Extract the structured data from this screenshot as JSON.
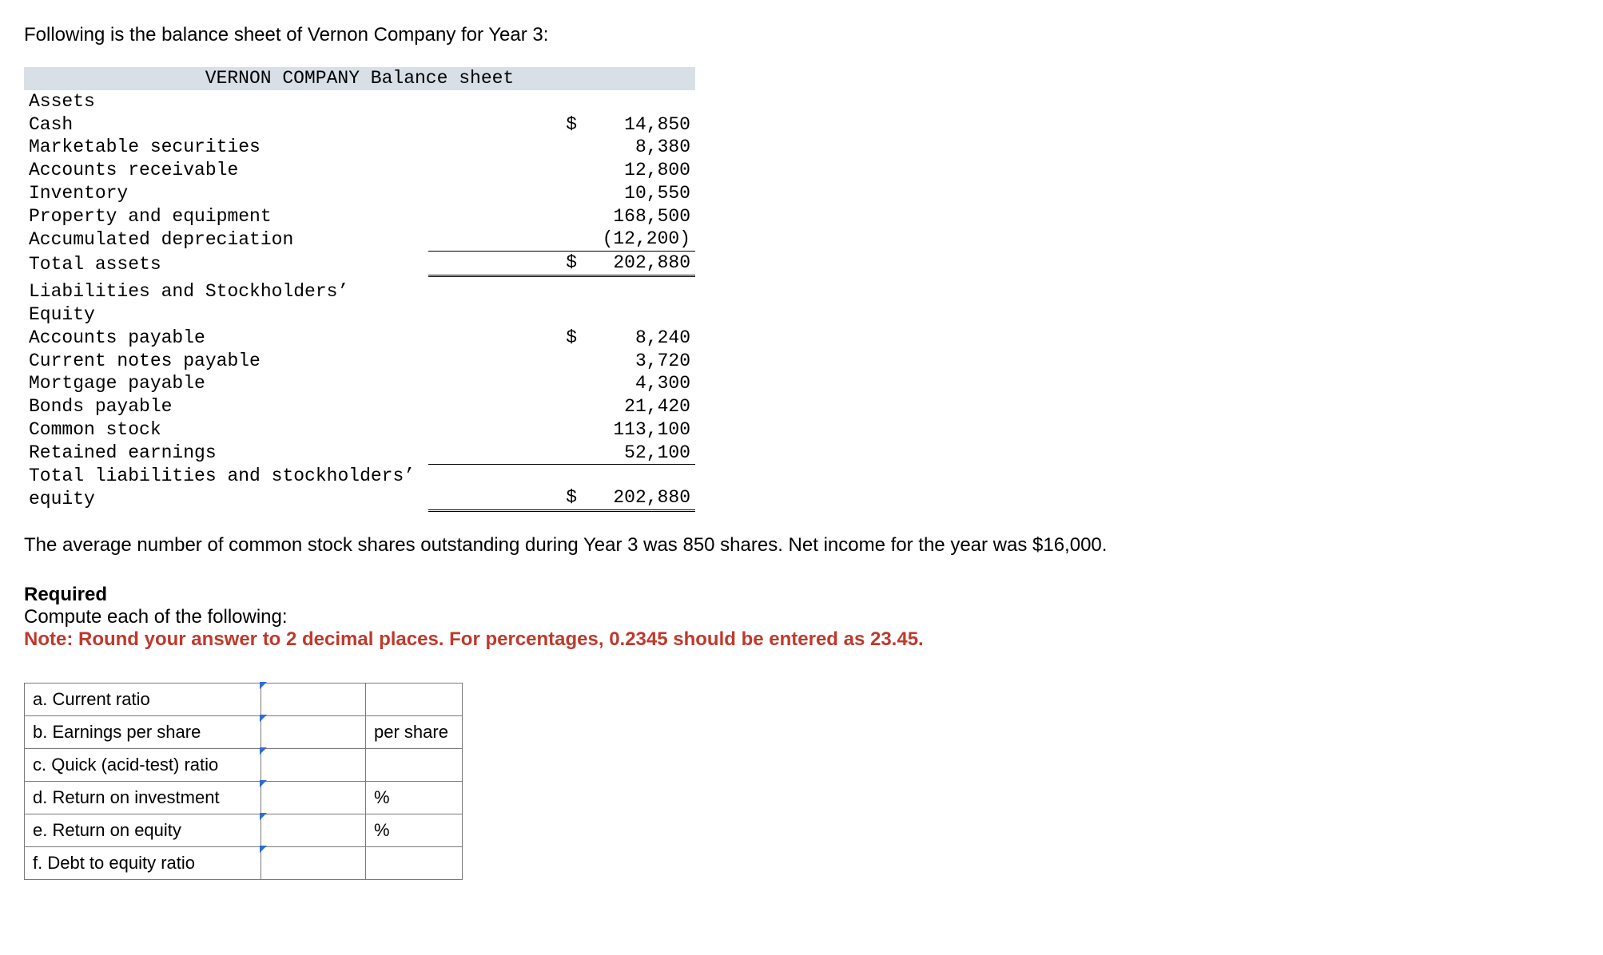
{
  "intro": "Following is the balance sheet of Vernon Company for Year 3:",
  "balance": {
    "title": "VERNON COMPANY Balance sheet",
    "assets_header": "Assets",
    "rows_assets": [
      {
        "label": "Cash",
        "sign": "$",
        "value": "14,850"
      },
      {
        "label": "Marketable securities",
        "sign": "",
        "value": "8,380"
      },
      {
        "label": "Accounts receivable",
        "sign": "",
        "value": "12,800"
      },
      {
        "label": "Inventory",
        "sign": "",
        "value": "10,550"
      },
      {
        "label": "Property and equipment",
        "sign": "",
        "value": "168,500"
      },
      {
        "label": "Accumulated depreciation",
        "sign": "",
        "value": "(12,200)"
      }
    ],
    "total_assets": {
      "label": "Total assets",
      "sign": "$",
      "value": "202,880"
    },
    "liab_header": "Liabilities and Stockholders’ Equity",
    "rows_liab": [
      {
        "label": "Accounts payable",
        "sign": "$",
        "value": "8,240"
      },
      {
        "label": "Current notes payable",
        "sign": "",
        "value": "3,720"
      },
      {
        "label": "Mortgage payable",
        "sign": "",
        "value": "4,300"
      },
      {
        "label": "Bonds payable",
        "sign": "",
        "value": "21,420"
      },
      {
        "label": "Common stock",
        "sign": "",
        "value": "113,100"
      },
      {
        "label": "Retained earnings",
        "sign": "",
        "value": "52,100"
      }
    ],
    "total_liab": {
      "label": "Total liabilities and stockholders’ equity",
      "sign": "$",
      "value": "202,880"
    }
  },
  "paragraph": "The average number of common stock shares outstanding during Year 3 was 850 shares. Net income for the year was $16,000.",
  "required_label": "Required",
  "required_text": "Compute each of the following:",
  "note": "Note: Round your answer to 2 decimal places. For percentages, 0.2345 should be entered as 23.45.",
  "answers": [
    {
      "label": "a. Current ratio",
      "unit": ""
    },
    {
      "label": "b. Earnings per share",
      "unit": "per share"
    },
    {
      "label": "c. Quick (acid-test) ratio",
      "unit": ""
    },
    {
      "label": "d. Return on investment",
      "unit": "%"
    },
    {
      "label": "e. Return on equity",
      "unit": "%"
    },
    {
      "label": "f. Debt to equity ratio",
      "unit": ""
    }
  ]
}
